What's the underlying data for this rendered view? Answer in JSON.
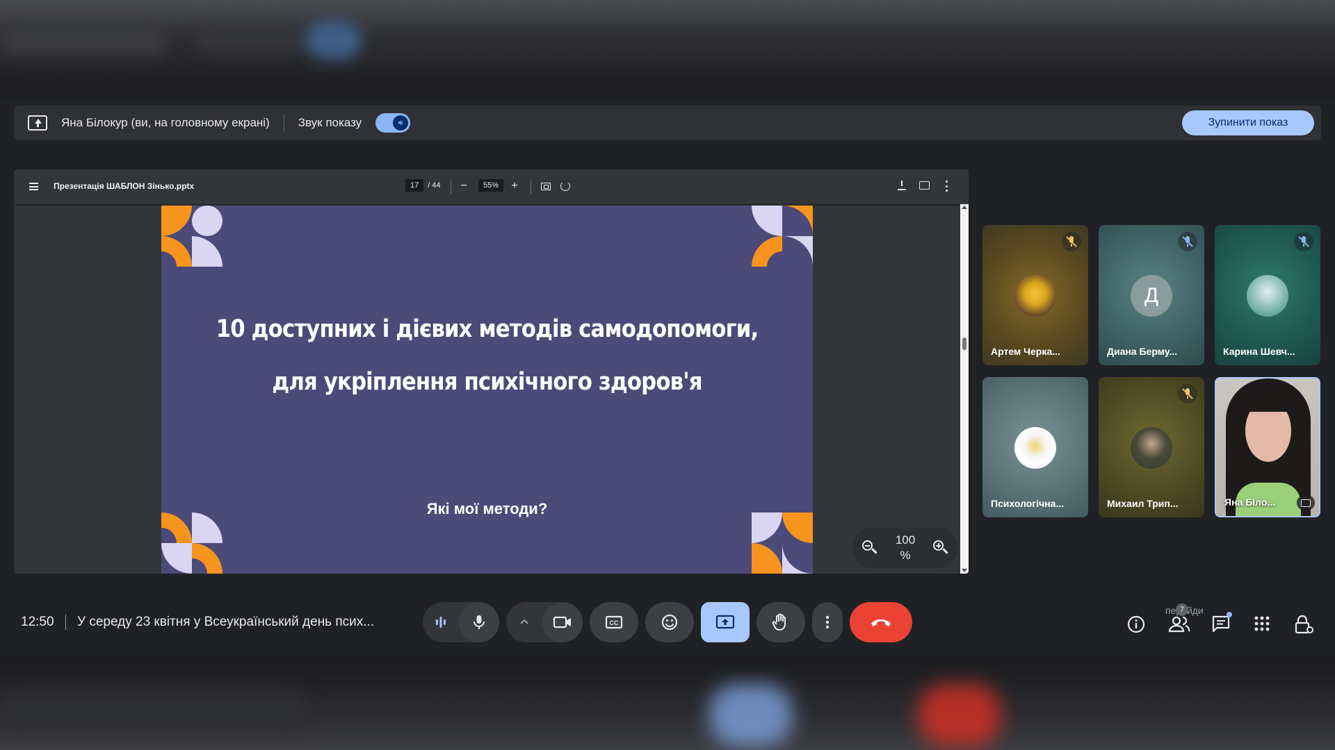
{
  "banner": {
    "presenter_text": "Яна Білокур (ви, на головному екрані)",
    "sound_label": "Звук показу",
    "stop_button": "Зупинити показ"
  },
  "pdf": {
    "filename": "Презентація ШАБЛОН Зінько.pptx",
    "page_current": "17",
    "page_total": "/ 44",
    "zoom": "55%",
    "overlay_zoom_value": "100",
    "overlay_zoom_unit": "%"
  },
  "slide": {
    "title_line1": "10 доступних і дієвих методів самодопомоги,",
    "title_line2": "для укріплення психічного здоров'я",
    "subtitle": "Які мої методи?",
    "colors": {
      "background": "#4c4a78",
      "orange": "#f7941d",
      "lavender": "#d9d5f3"
    }
  },
  "participants": [
    {
      "name": "Артем Черка...",
      "avatar": "pikachu-avatar",
      "muted": true
    },
    {
      "name": "Диана Берму...",
      "initial": "Д",
      "muted": true
    },
    {
      "name": "Карина Шевч...",
      "avatar": "angel-avatar",
      "muted": true
    },
    {
      "name": "Психологічна...",
      "avatar": "psych-service-logo",
      "muted": false
    },
    {
      "name": "Михаил Трип...",
      "avatar": "person-avatar",
      "muted": true
    },
    {
      "name": "Яна Біло...",
      "avatar": "webcam-video",
      "muted": false,
      "active": true
    }
  ],
  "bottom_bar": {
    "time": "12:50",
    "meeting_title": "У середу 23 квітня у Всеукраїнський день псих...",
    "participants_count": "7",
    "hint_text": "перейди"
  },
  "accent_colors": {
    "stop_button": "#a8c7fa",
    "end_call": "#ea4335",
    "active_control": "#a8c7fa"
  }
}
